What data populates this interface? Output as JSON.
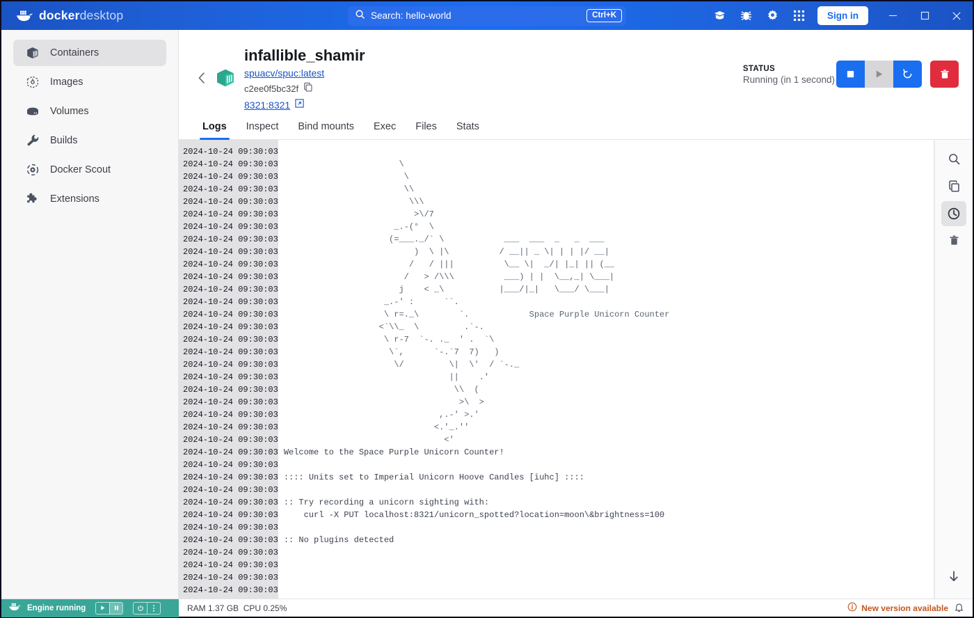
{
  "titlebar": {
    "brand_bold": "docker",
    "brand_light": "desktop",
    "logo_icon": "docker-whale-icon",
    "search": {
      "icon": "search-icon",
      "value": "Search: hello-world",
      "placeholder": "Search",
      "shortcut": "Ctrl+K"
    },
    "icons": [
      {
        "name": "learning-center-icon",
        "glyph": "book"
      },
      {
        "name": "bug-report-icon",
        "glyph": "bug"
      },
      {
        "name": "settings-gear-icon",
        "glyph": "gear"
      },
      {
        "name": "app-grid-icon",
        "glyph": "grid"
      }
    ],
    "sign_in_label": "Sign in",
    "window_controls": [
      {
        "name": "minimize-button",
        "glyph": "minimize"
      },
      {
        "name": "maximize-button",
        "glyph": "maximize"
      },
      {
        "name": "close-button",
        "glyph": "close"
      }
    ]
  },
  "sidebar": {
    "items": [
      {
        "label": "Containers",
        "icon": "container-icon",
        "active": true
      },
      {
        "label": "Images",
        "icon": "images-icon",
        "active": false
      },
      {
        "label": "Volumes",
        "icon": "volumes-icon",
        "active": false
      },
      {
        "label": "Builds",
        "icon": "wrench-icon",
        "active": false
      },
      {
        "label": "Docker Scout",
        "icon": "scout-icon",
        "active": false
      },
      {
        "label": "Extensions",
        "icon": "puzzle-icon",
        "active": false
      }
    ]
  },
  "container": {
    "name": "infallible_shamir",
    "image": "spuacv/spuc:latest",
    "id": "c2ee0f5bc32f",
    "port": "8321:8321",
    "copy_icon": "copy-icon",
    "external_link_icon": "external-link-icon",
    "back_icon": "chevron-left-icon",
    "cube_icon": "container-cube-icon",
    "status_label": "STATUS",
    "status_value": "Running (in 1 second)",
    "actions": [
      {
        "name": "stop-button",
        "icon": "stop-icon",
        "style": "blue",
        "enabled": true
      },
      {
        "name": "start-button",
        "icon": "play-icon",
        "style": "gray",
        "enabled": false
      },
      {
        "name": "restart-button",
        "icon": "restart-icon",
        "style": "blue",
        "enabled": true
      },
      {
        "name": "delete-button",
        "icon": "trash-icon",
        "style": "red",
        "enabled": true
      }
    ]
  },
  "tabs": [
    {
      "label": "Logs",
      "active": true
    },
    {
      "label": "Inspect",
      "active": false
    },
    {
      "label": "Bind mounts",
      "active": false
    },
    {
      "label": "Exec",
      "active": false
    },
    {
      "label": "Files",
      "active": false
    },
    {
      "label": "Stats",
      "active": false
    }
  ],
  "logs": {
    "timestamp": "2024-10-24 09:30:03",
    "line_count": 36,
    "timestamps": [
      "2024-10-24 09:30:03",
      "2024-10-24 09:30:03",
      "2024-10-24 09:30:03",
      "2024-10-24 09:30:03",
      "2024-10-24 09:30:03",
      "2024-10-24 09:30:03",
      "2024-10-24 09:30:03",
      "2024-10-24 09:30:03",
      "2024-10-24 09:30:03",
      "2024-10-24 09:30:03",
      "2024-10-24 09:30:03",
      "2024-10-24 09:30:03",
      "2024-10-24 09:30:03",
      "2024-10-24 09:30:03",
      "2024-10-24 09:30:03",
      "2024-10-24 09:30:03",
      "2024-10-24 09:30:03",
      "2024-10-24 09:30:03",
      "2024-10-24 09:30:03",
      "2024-10-24 09:30:03",
      "2024-10-24 09:30:03",
      "2024-10-24 09:30:03",
      "2024-10-24 09:30:03",
      "2024-10-24 09:30:03",
      "2024-10-24 09:30:03",
      "2024-10-24 09:30:03",
      "2024-10-24 09:30:03",
      "2024-10-24 09:30:03",
      "2024-10-24 09:30:03",
      "2024-10-24 09:30:03",
      "2024-10-24 09:30:03",
      "2024-10-24 09:30:03",
      "2024-10-24 09:30:03",
      "2024-10-24 09:30:03",
      "2024-10-24 09:30:03",
      "2024-10-24 09:30:03"
    ],
    "banner_title": "Space Purple Unicorn Counter",
    "ascii_art": "\n                       \\\n                        \\\n                        \\\\\n                         \\\\\\\n                          >\\/7\n                      _.-(°  \\\n                     (=___._/` \\            ___  ___  _   _  ___\n                          )  \\ |\\          / __|| _ \\| | | |/ __|\n                         /   / |||          \\__ \\|  _/| |_| || (__\n                        /   > /\\\\\\          ___) | |  \\__,_| \\___|\n                       j    < _\\           |___/|_|   \\___/ \\___|\n                    _.-' :      ``.\n                    \\ r=._\\        `.            Space Purple Unicorn Counter\n                   <`\\\\_  \\         .`-.\n                    \\ r-7  `-. ._  ' .  `\\\n                     \\`,      `-.`7  7)   )\n                      \\/         \\|  \\'  / `-._\n                                 ||    .'\n                                  \\\\  (\n                                   >\\  >\n                               ,.-' >.'\n                              <.'_.''\n                                <'\n",
    "lines": [
      "Welcome to the Space Purple Unicorn Counter!",
      "",
      ":::: Units set to Imperial Unicorn Hoove Candles [iuhc] ::::",
      "",
      ":: Try recording a unicorn sighting with:",
      "    curl -X PUT localhost:8321/unicorn_spotted?location=moon\\&brightness=100",
      "",
      ":: No plugins detected"
    ],
    "tools": [
      {
        "name": "log-search-button",
        "icon": "search-icon",
        "active": false
      },
      {
        "name": "log-copy-button",
        "icon": "copy-icon",
        "active": false
      },
      {
        "name": "log-timestamps-button",
        "icon": "clock-icon",
        "active": true
      },
      {
        "name": "log-clear-button",
        "icon": "trash-icon",
        "active": false
      }
    ],
    "scroll_bottom_icon": "arrow-down-icon"
  },
  "statusbar": {
    "engine_label": "Engine running",
    "engine_icon": "docker-whale-icon",
    "engine_controls": [
      {
        "name": "engine-start-button",
        "icon": "play-icon",
        "active": false
      },
      {
        "name": "engine-pause-button",
        "icon": "pause-icon",
        "active": true
      }
    ],
    "power_controls": [
      {
        "name": "engine-power-button",
        "icon": "power-icon"
      },
      {
        "name": "engine-more-button",
        "icon": "kebab-menu-icon"
      }
    ],
    "ram": "RAM 1.37 GB",
    "cpu": "CPU 0.25%",
    "new_version": "New version available",
    "new_version_icon": "info-circle-icon",
    "notification_icon": "bell-icon"
  },
  "colors": {
    "brand_blue": "#1a6ef0",
    "deep_blue": "#1a53c4",
    "danger_red": "#e02c3d",
    "engine_teal": "#3aa698",
    "warn_orange": "#c4551f",
    "log_text": "#5a6476",
    "gutter_bg": "#e2e2e5"
  }
}
